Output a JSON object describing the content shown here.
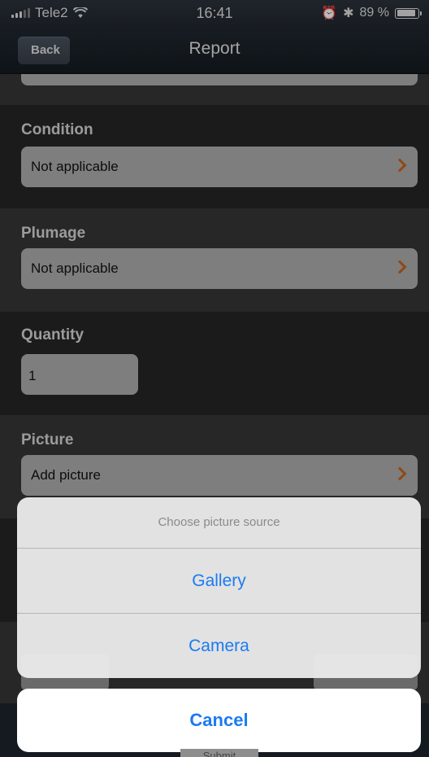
{
  "status_bar": {
    "carrier": "Tele2",
    "time": "16:41",
    "battery_percent": "89 %",
    "battery_level": 0.89
  },
  "nav": {
    "back_label": "Back",
    "title": "Report"
  },
  "form": {
    "condition": {
      "label": "Condition",
      "value": "Not applicable"
    },
    "plumage": {
      "label": "Plumage",
      "value": "Not applicable"
    },
    "quantity": {
      "label": "Quantity",
      "value": "1"
    },
    "picture": {
      "label": "Picture",
      "value": "Add picture"
    }
  },
  "action_sheet": {
    "title": "Choose picture source",
    "options": [
      "Gallery",
      "Camera"
    ],
    "cancel_label": "Cancel"
  },
  "footer": {
    "submit_label": "Submit"
  },
  "colors": {
    "accent": "#1a7bf2",
    "chevron": "#c2611c"
  }
}
